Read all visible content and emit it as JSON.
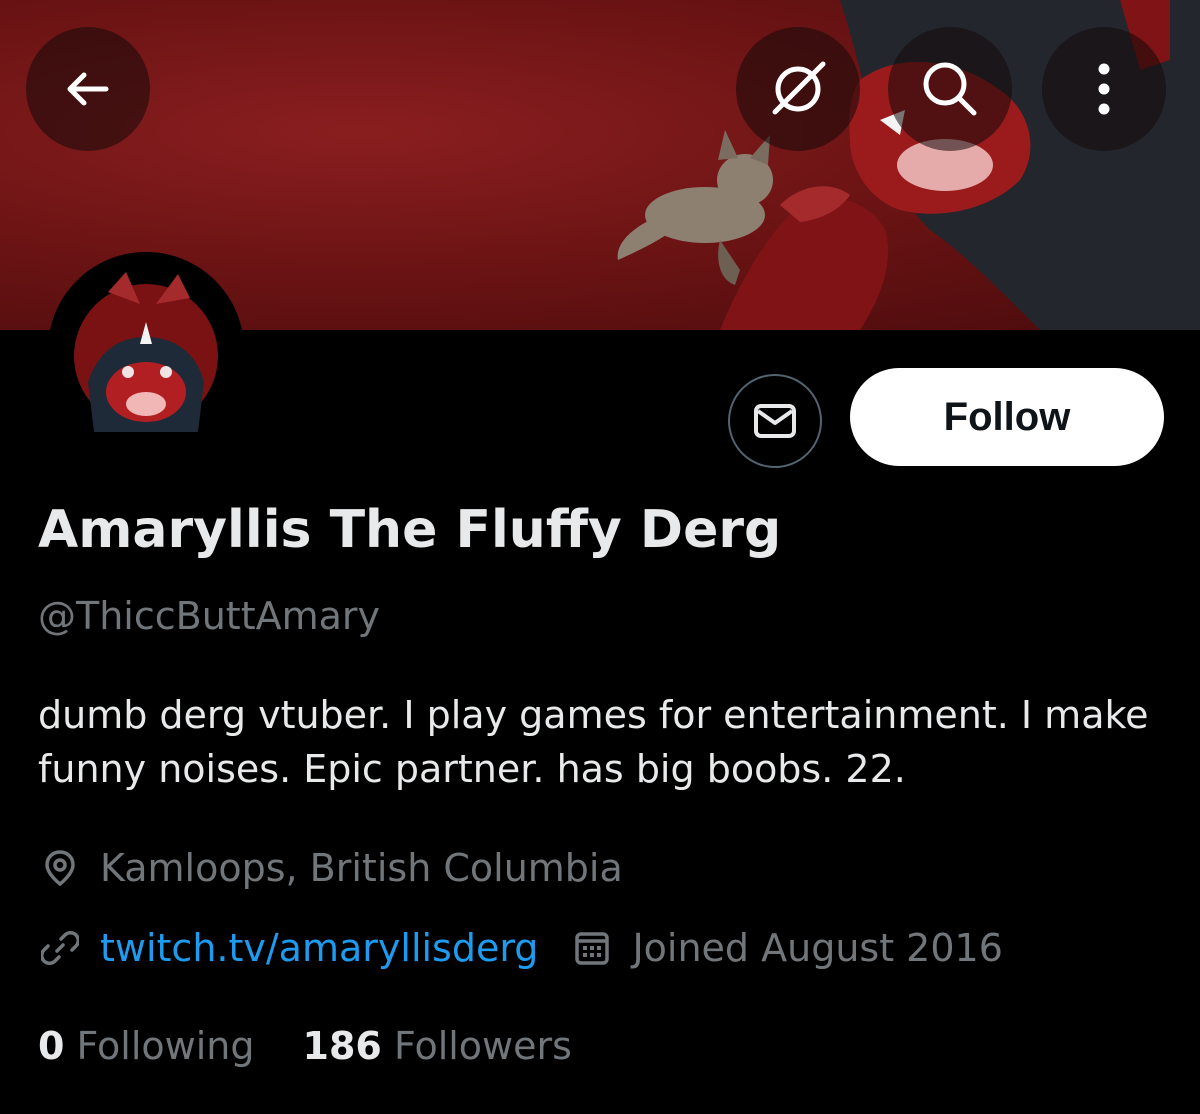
{
  "profile": {
    "display_name": "Amaryllis The Fluffy Derg",
    "handle": "@ThiccButtAmary",
    "bio": "dumb derg vtuber. I play games for entertainment. I make funny noises. Epic partner. has big boobs. 22.",
    "location": "Kamloops, British Columbia",
    "website": "twitch.tv/amaryllisderg",
    "joined": "Joined August 2016"
  },
  "stats": {
    "following_count": "0",
    "following_label": "Following",
    "followers_count": "186",
    "followers_label": "Followers"
  },
  "actions": {
    "follow_label": "Follow"
  },
  "icons": {
    "back": "arrow-left-icon",
    "mute": "mute-icon",
    "search": "search-icon",
    "more": "more-vertical-icon",
    "message": "envelope-icon",
    "location": "location-pin-icon",
    "link": "link-icon",
    "calendar": "calendar-icon"
  },
  "colors": {
    "background": "#000000",
    "text_primary": "#e7e9ea",
    "text_secondary": "#71767b",
    "link": "#1d9bf0",
    "banner": "#6e1415"
  }
}
